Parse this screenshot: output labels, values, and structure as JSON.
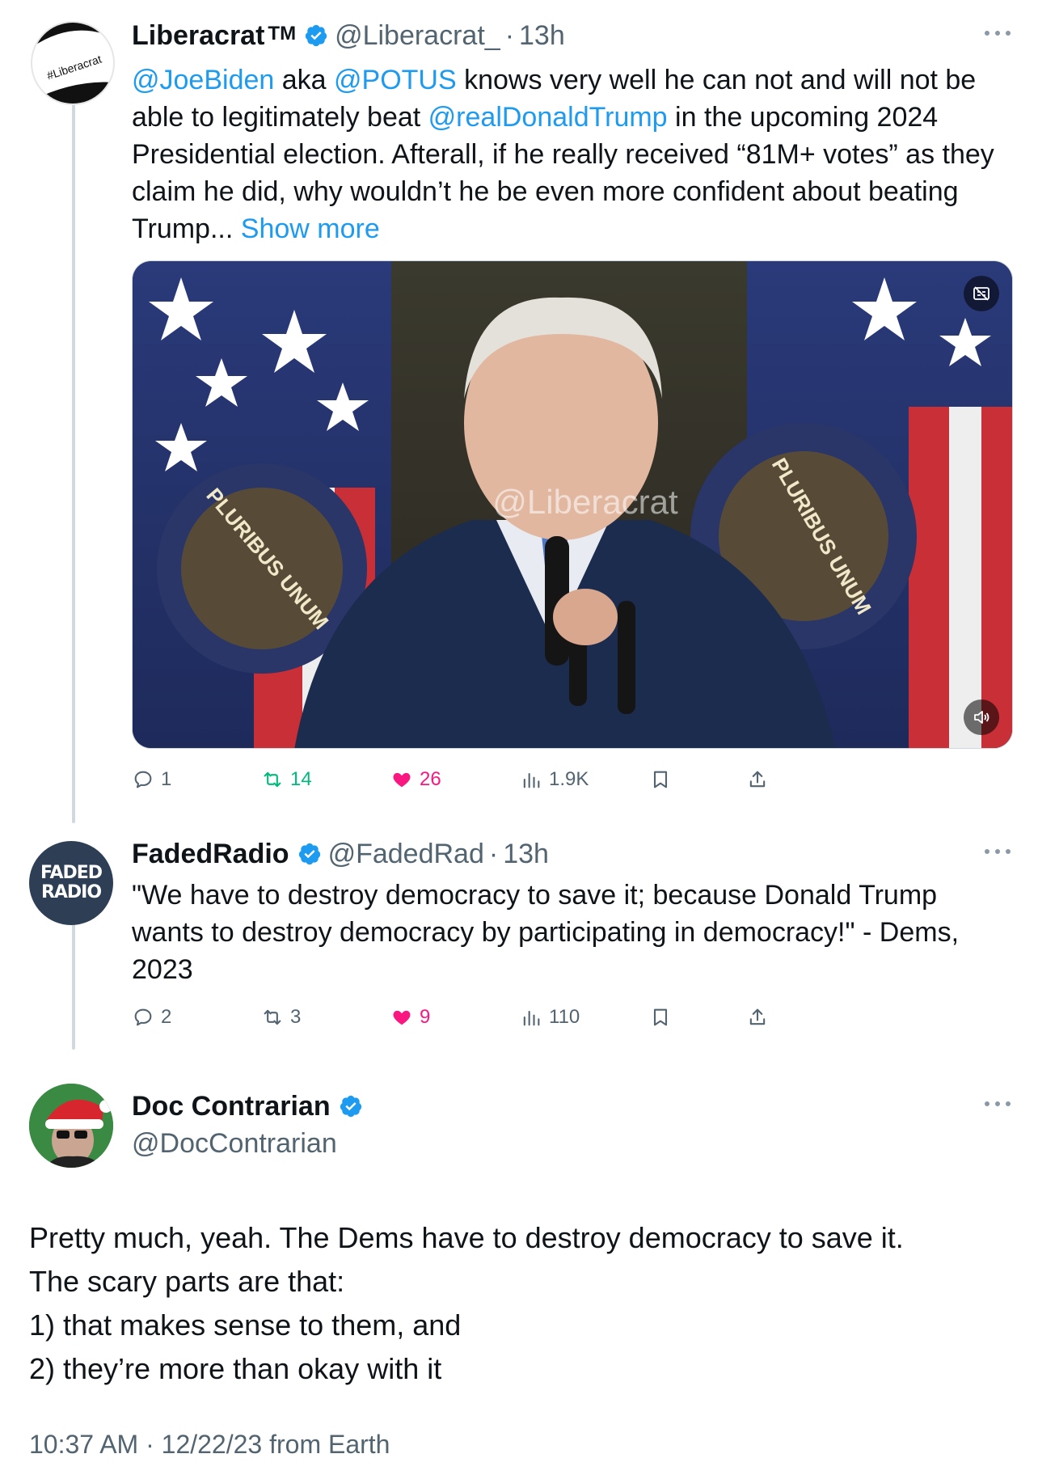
{
  "tweets": [
    {
      "name": "Liberacrat",
      "tm": "TM",
      "handle": "@Liberacrat_",
      "time": "13h",
      "avatar_text": "#Liberacrat",
      "text_parts": {
        "m1": "@JoeBiden",
        "t1": " aka ",
        "m2": "@POTUS",
        "t2": " knows very well he can not and will not be able to legitimately beat ",
        "m3": "@realDonaldTrump",
        "t3": " in the upcoming 2024 Presidential election. Afterall, if he really received “81M+ votes” as they claim he did, why wouldn’t he be even more confident about beating Trump... ",
        "show_more": "Show more"
      },
      "video": {
        "watermark": "@Liberacrat",
        "seal_text_left": "PLURIBUS UNUM",
        "seal_text_right": "PLURIBUS UNUM",
        "captions_icon": "captions-icon",
        "mute_icon": "speaker-icon"
      },
      "stats": {
        "replies": "1",
        "reposts": "14",
        "likes": "26",
        "views": "1.9K"
      }
    },
    {
      "name": "FadedRadio",
      "handle": "@FadedRad",
      "time": "13h",
      "avatar_line1": "FADED",
      "avatar_line2": "RADIO",
      "text": "\"We have to destroy democracy to save it; because Donald Trump wants to destroy democracy by participating in democracy!\" - Dems, 2023",
      "stats": {
        "replies": "2",
        "reposts": "3",
        "likes": "9",
        "views": "110"
      }
    }
  ],
  "main": {
    "name": "Doc Contrarian",
    "handle": "@DocContrarian",
    "lines": [
      "Pretty much, yeah. The Dems have to destroy democracy to save it.",
      "The scary parts are that:",
      "1) that makes sense to them, and",
      "2) they’re more than okay with it"
    ],
    "footer": "10:37 AM · 12/22/23 from Earth"
  },
  "colors": {
    "link": "#1d9bf0",
    "repost": "#00ba7c",
    "like": "#f91880",
    "muted": "#536471",
    "verified": "#1d9bf0"
  }
}
